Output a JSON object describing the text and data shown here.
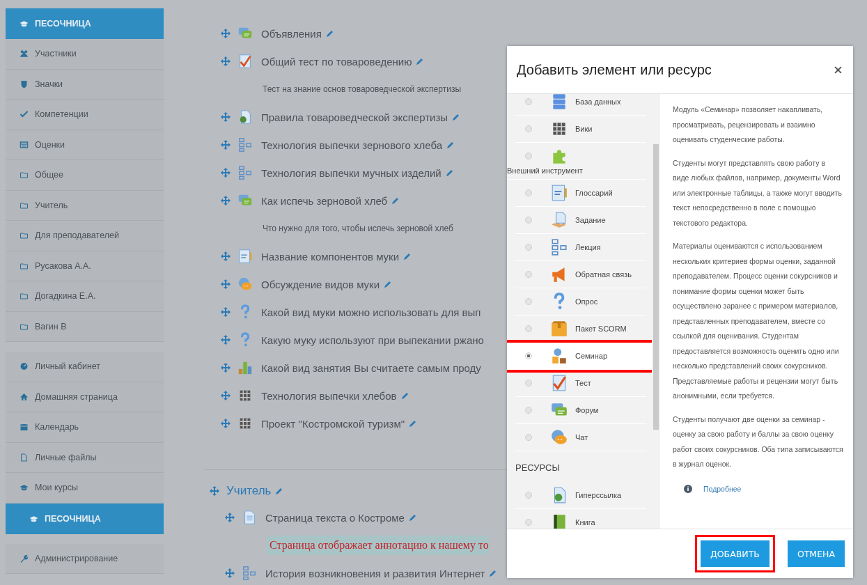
{
  "sidebar": {
    "course_header": "ПЕСОЧНИЦА",
    "course_items": [
      {
        "kind": "participants",
        "label": "Участники"
      },
      {
        "kind": "badges",
        "label": "Значки"
      },
      {
        "kind": "competencies",
        "label": "Компетенции"
      },
      {
        "kind": "grades",
        "label": "Оценки"
      },
      {
        "kind": "folder",
        "label": "Общее"
      },
      {
        "kind": "folder",
        "label": "Учитель"
      },
      {
        "kind": "folder",
        "label": "Для преподавателей"
      },
      {
        "kind": "folder",
        "label": "Русакова А.А."
      },
      {
        "kind": "folder",
        "label": "Догадкина Е.А."
      },
      {
        "kind": "folder",
        "label": "Вагин В"
      }
    ],
    "nav_items": [
      {
        "kind": "dashboard",
        "label": "Личный кабинет"
      },
      {
        "kind": "home",
        "label": "Домашняя страница"
      },
      {
        "kind": "calendar",
        "label": "Календарь"
      },
      {
        "kind": "files",
        "label": "Личные файлы"
      },
      {
        "kind": "courses",
        "label": "Мои курсы"
      }
    ],
    "current_course": "ПЕСОЧНИЦА",
    "admin": "Администрирование"
  },
  "course": {
    "sections": [
      {
        "items": [
          {
            "kind": "forum",
            "title": "Объявления",
            "editable": true
          },
          {
            "kind": "quiz",
            "title": "Общий тест по товароведению",
            "editable": true
          },
          {
            "kind": "description",
            "title": "Тест на знание основ товароведческой экспертизы"
          },
          {
            "kind": "page",
            "title": "Правила товароведческой экспертизы",
            "editable": true
          },
          {
            "kind": "lesson",
            "title": "Технология выпечки зернового хлеба",
            "editable": true
          },
          {
            "kind": "lesson",
            "title": "Технология выпечки мучных изделий",
            "editable": true
          },
          {
            "kind": "forum",
            "title": "Как испечь зерновой хлеб",
            "editable": true
          },
          {
            "kind": "description",
            "title": "Что нужно для того, чтобы испечь зерновой хлеб"
          },
          {
            "kind": "glossary",
            "title": "Название компонентов муки",
            "editable": true
          },
          {
            "kind": "chat",
            "title": "Обсуждение видов муки",
            "editable": true
          },
          {
            "kind": "survey",
            "title": "Какой вид муки можно использовать для вып",
            "editable": false
          },
          {
            "kind": "survey",
            "title": "Какую муку используют при выпекании ржано",
            "editable": false
          },
          {
            "kind": "choice",
            "title": "Какой вид занятия Вы считаете самым проду",
            "editable": false
          },
          {
            "kind": "wiki",
            "title": "Технология выпечки хлебов",
            "editable": true
          },
          {
            "kind": "wiki",
            "title": "Проект \"Костромской туризм\"",
            "editable": true
          }
        ]
      },
      {
        "title": "Учитель",
        "items": [
          {
            "kind": "page-doc",
            "title": "Страница текста о Костроме",
            "editable": true
          },
          {
            "kind": "annotation",
            "title": "Страница отображает аннотацию к нашему то"
          },
          {
            "kind": "lesson",
            "title": "История возникновения и развития Интернет",
            "editable": true
          }
        ]
      }
    ]
  },
  "modal": {
    "title": "Добавить элемент или ресурс",
    "options": [
      {
        "kind": "database",
        "label": "База данных",
        "selected": false
      },
      {
        "kind": "wiki",
        "label": "Вики",
        "selected": false
      },
      {
        "kind": "lti",
        "label": "Внешний инструмент",
        "selected": false
      },
      {
        "kind": "glossary",
        "label": "Глоссарий",
        "selected": false
      },
      {
        "kind": "assign",
        "label": "Задание",
        "selected": false
      },
      {
        "kind": "lesson",
        "label": "Лекция",
        "selected": false
      },
      {
        "kind": "feedback",
        "label": "Обратная связь",
        "selected": false
      },
      {
        "kind": "survey",
        "label": "Опрос",
        "selected": false
      },
      {
        "kind": "scorm",
        "label": "Пакет SCORM",
        "selected": false
      },
      {
        "kind": "workshop",
        "label": "Семинар",
        "selected": true
      },
      {
        "kind": "quiz",
        "label": "Тест",
        "selected": false
      },
      {
        "kind": "forum",
        "label": "Форум",
        "selected": false
      },
      {
        "kind": "chat",
        "label": "Чат",
        "selected": false
      },
      {
        "kind": "heading",
        "label": "РЕСУРСЫ"
      },
      {
        "kind": "url",
        "label": "Гиперссылка",
        "selected": false
      },
      {
        "kind": "book",
        "label": "Книга",
        "selected": false
      }
    ],
    "description": [
      "Модуль «Семинар» позволяет накапливать, просматривать, рецензировать и взаимно оценивать студенческие работы.",
      "Студенты могут представлять свою работу в виде любых файлов, например, документы Word или электронные таблицы, а также могут вводить текст непосредственно в поле с помощью текстового редактора.",
      "Материалы оцениваются с использованием нескольких критериев формы оценки, заданной преподавателем. Процесс оценки сокурсников и понимание формы оценки может быть осуществлено заранее с примером материалов, представленных преподавателем, вместе со ссылкой для оценивания. Студентам предоставляется возможность оценить одно или несколько представлений своих сокурсников. Представляемые работы и рецензии могут быть анонимными, если требуется.",
      "Студенты получают две оценки за семинар - оценку за свою работу и баллы за свою оценку работ своих сокурсников. Оба типа записываются в журнал оценок."
    ],
    "more_link": "Подробнее",
    "buttons": [
      {
        "label": "ДОБАВИТЬ",
        "highlighted": true
      },
      {
        "label": "ОТМЕНА",
        "highlighted": false
      }
    ]
  }
}
